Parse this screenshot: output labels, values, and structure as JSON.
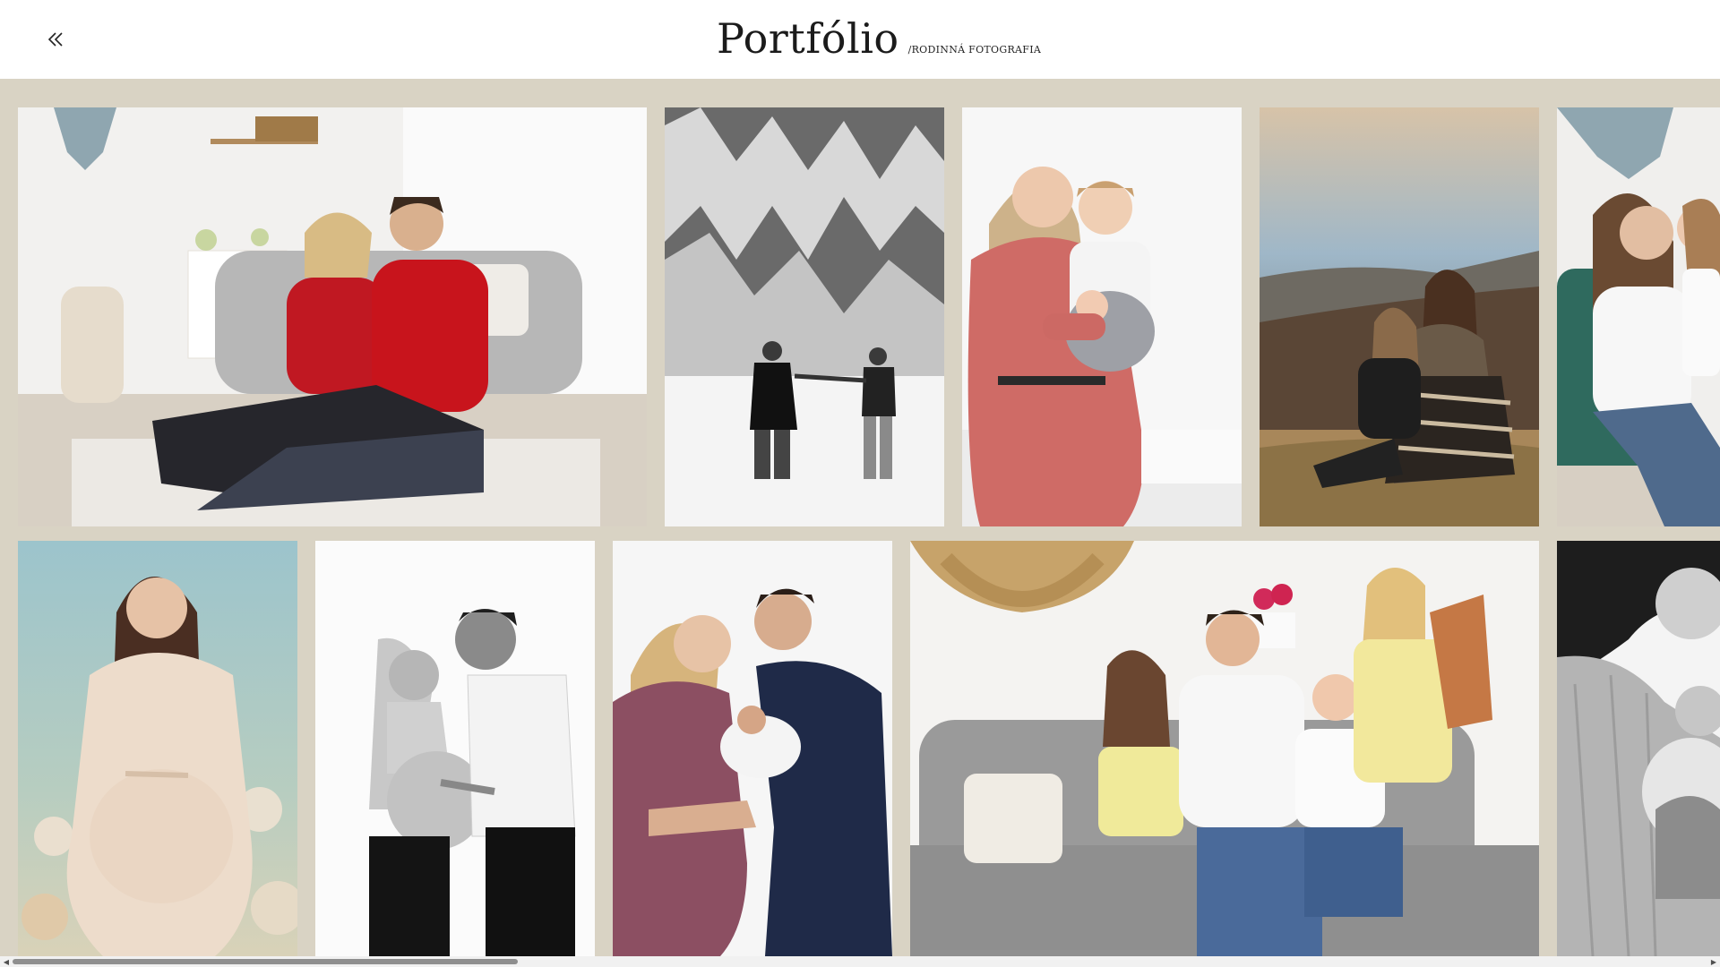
{
  "header": {
    "title": "Portfólio",
    "subtitle": "/RODINNÁ FOTOGRAFIA",
    "back_icon": "double-chevron-left-icon"
  },
  "gallery": {
    "background": "#d9d3c4",
    "photos": [
      {
        "id": "couple-red-sofa",
        "row": 1
      },
      {
        "id": "couple-snow-forest-bw",
        "row": 1
      },
      {
        "id": "mother-son-newborn",
        "row": 1
      },
      {
        "id": "mother-daughter-hills",
        "row": 1
      },
      {
        "id": "mother-daughter-green-chair",
        "row": 1
      },
      {
        "id": "pregnant-woman-flowers",
        "row": 2
      },
      {
        "id": "couple-pregnancy-bw",
        "row": 2
      },
      {
        "id": "parents-newborn",
        "row": 2
      },
      {
        "id": "family-four-sofa",
        "row": 2
      },
      {
        "id": "mother-newborn-bw",
        "row": 2
      }
    ]
  },
  "scrollbar": {
    "left_arrow": "◀",
    "right_arrow": "▶"
  }
}
